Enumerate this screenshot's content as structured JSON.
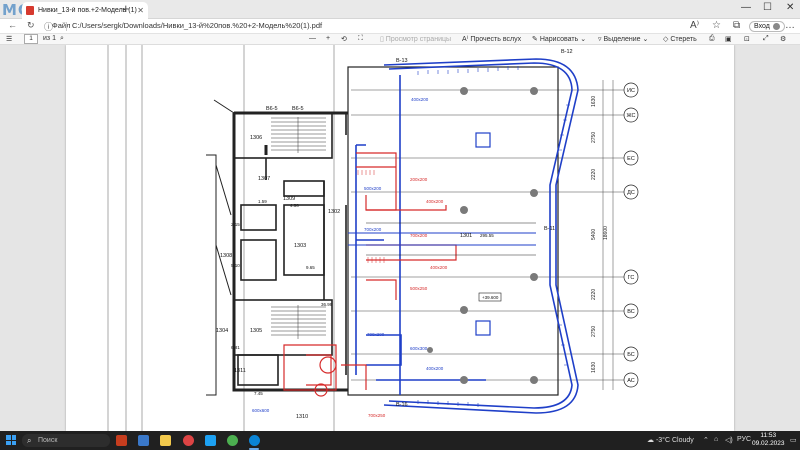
{
  "watermark": "MGA",
  "tab": {
    "title": "Нивки_13-й пов.+2-Модель (1)..."
  },
  "address": {
    "prefix": "Файл",
    "url": "C:/Users/sergk/Downloads/Нивки_13-й%20пов.%20+2-Модель%20(1).pdf",
    "signin_label": "Вход"
  },
  "pdf_toolbar": {
    "page_current": "1",
    "page_total": "из 1",
    "zoom_minus": "—",
    "zoom_plus": "+",
    "page_view": "Просмотр страницы",
    "read_aloud": "Прочесть вслух",
    "draw": "Нарисовать",
    "highlight": "Выделение",
    "erase": "Стереть"
  },
  "drawing": {
    "grid_axes": [
      "ИС",
      "ЖС",
      "ЕС",
      "ДС",
      "ГС",
      "ВС",
      "БС",
      "АС"
    ],
    "axis_labels": {
      "top": "В-13",
      "right": "В-12",
      "side": "В-11",
      "bottom": "В-16",
      "left1": "В6-5",
      "left2": "В6-5"
    },
    "rooms": [
      {
        "id": "1306"
      },
      {
        "id": "1307"
      },
      {
        "id": "1309"
      },
      {
        "id": "1308"
      },
      {
        "id": "1303"
      },
      {
        "id": "1302"
      },
      {
        "id": "1304"
      },
      {
        "id": "1305"
      },
      {
        "id": "1311"
      },
      {
        "id": "1310"
      },
      {
        "id": "1301"
      }
    ],
    "areas": [
      "1.59",
      "4.56",
      "2.15",
      "5.10",
      "9.65",
      "36.99",
      "6.81",
      "7.45",
      "295.55"
    ],
    "duct_labels_blue": [
      "400x200",
      "500x200",
      "700x200",
      "700x200",
      "600x300",
      "400x200",
      "600x600"
    ],
    "duct_labels_red": [
      "200x200",
      "400x200",
      "700x200",
      "400x200",
      "500x250",
      "700x250"
    ],
    "elevation": "+39.600",
    "dims": [
      "1630",
      "2750",
      "2220",
      "5400",
      "18600",
      "2220",
      "2750",
      "1630"
    ]
  },
  "taskbar": {
    "search_placeholder": "Поиск",
    "weather": "-3°C Cloudy",
    "lang": "РУС",
    "time": "11:53",
    "date": "09.02.2023"
  },
  "colors": {
    "duct_blue": "#1f3fc8",
    "duct_red": "#d62b2b",
    "column_gray": "#7a7a7a"
  }
}
